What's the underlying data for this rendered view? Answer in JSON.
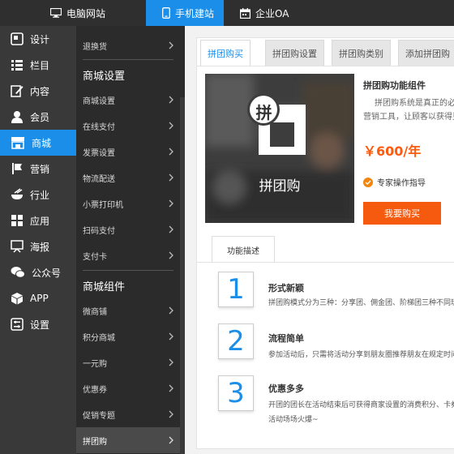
{
  "topbar": {
    "tabs": [
      {
        "label": "电脑网站",
        "icon": "monitor-icon"
      },
      {
        "label": "手机建站",
        "icon": "phone-icon"
      },
      {
        "label": "企业OA",
        "icon": "calendar-icon"
      }
    ],
    "active_color": "#1a8ee8"
  },
  "sidebar": {
    "items": [
      {
        "label": "设计",
        "icon": "design-icon"
      },
      {
        "label": "栏目",
        "icon": "column-list-icon"
      },
      {
        "label": "内容",
        "icon": "edit-icon"
      },
      {
        "label": "会员",
        "icon": "user-icon"
      },
      {
        "label": "商城",
        "icon": "store-icon"
      },
      {
        "label": "营销",
        "icon": "marketing-flag-icon"
      },
      {
        "label": "行业",
        "icon": "bowl-icon"
      },
      {
        "label": "应用",
        "icon": "apps-grid-icon"
      },
      {
        "label": "海报",
        "icon": "poster-icon"
      },
      {
        "label": "公众号",
        "icon": "wechat-icon"
      },
      {
        "label": "APP",
        "icon": "cube-icon"
      },
      {
        "label": "设置",
        "icon": "settings-icon"
      }
    ],
    "active": "商城"
  },
  "submenu": {
    "top_item": "退换货",
    "heading1": "商城设置",
    "group1": [
      "商城设置",
      "在线支付",
      "发票设置",
      "物流配送",
      "小票打印机",
      "扫码支付",
      "支付卡"
    ],
    "heading2": "商城组件",
    "group2": [
      "微商铺",
      "积分商城",
      "一元购",
      "优惠券",
      "促销专题",
      "拼团购"
    ],
    "active": "拼团购"
  },
  "main": {
    "tabs": [
      "拼团购买",
      "拼团购设置",
      "拼团购类别",
      "添加拼团购"
    ],
    "active_tab": "拼团购买",
    "product": {
      "logo_char": "拼",
      "logo_label": "拼团购",
      "title": "拼团购功能组件",
      "desc": "拼团购系统是真正的必备营销工具，让顾客以获得更优惠的价格，会通过",
      "price": "￥600/年",
      "features": [
        "专家操作指导"
      ],
      "buy_label": "我要购买",
      "price_color": "#ff5a0d"
    },
    "sub_tab": "功能描述",
    "points": [
      {
        "num": "1",
        "title": "形式新颖",
        "lines": [
          "拼团购模式分为三种：分享团、佣金团、阶梯团三种不同玩法"
        ]
      },
      {
        "num": "2",
        "title": "流程简单",
        "lines": [
          "参加活动后，只需将活动分享到朋友圈推荐朋友在规定时间内参团"
        ]
      },
      {
        "num": "3",
        "title": "优惠多多",
        "lines": [
          "开团的团长在活动结束后可获得商家设置的消费积分、卡券等奖励",
          "活动场场火爆~"
        ]
      }
    ]
  }
}
